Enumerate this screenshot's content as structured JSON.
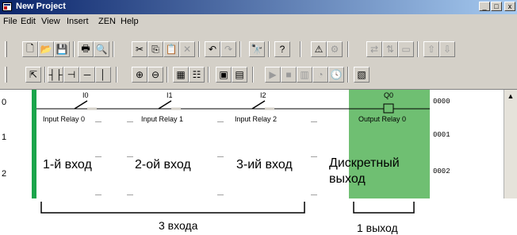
{
  "window": {
    "title": "New Project",
    "controls": [
      "_",
      "□",
      "x"
    ]
  },
  "menu": [
    "File",
    "Edit",
    "View",
    "Insert",
    "ZEN",
    "Help"
  ],
  "toolbar1": [
    {
      "icon": "new-file-icon",
      "glyph": "🗋"
    },
    {
      "icon": "open-folder-icon",
      "glyph": "📂"
    },
    {
      "icon": "save-icon",
      "glyph": "💾"
    },
    {
      "icon": "print-icon",
      "glyph": "🖶"
    },
    {
      "icon": "print-preview-icon",
      "glyph": "🔍"
    },
    {
      "icon": "cut-icon",
      "glyph": "✂"
    },
    {
      "icon": "copy-icon",
      "glyph": "⎘"
    },
    {
      "icon": "paste-icon",
      "glyph": "📋"
    },
    {
      "icon": "delete-icon",
      "glyph": "✕"
    },
    {
      "icon": "undo-icon",
      "glyph": "↶"
    },
    {
      "icon": "redo-icon",
      "glyph": "↷"
    },
    {
      "icon": "find-icon",
      "glyph": "🔭"
    },
    {
      "icon": "help-icon",
      "glyph": "?"
    },
    {
      "icon": "warning-check-icon",
      "glyph": "⚠"
    },
    {
      "icon": "compile-icon",
      "glyph": "⚙"
    },
    {
      "icon": "transfer-icon",
      "glyph": "⇄"
    },
    {
      "icon": "compare-icon",
      "glyph": "⇅"
    },
    {
      "icon": "monitor-icon",
      "glyph": "▭"
    },
    {
      "icon": "upload-icon",
      "glyph": "⇧"
    },
    {
      "icon": "download-icon",
      "glyph": "⇩"
    }
  ],
  "toolbar2": [
    {
      "icon": "pointer-icon",
      "glyph": "⇱"
    },
    {
      "icon": "contact-no-icon",
      "glyph": "┤├"
    },
    {
      "icon": "contact-nc-icon",
      "glyph": "⊣"
    },
    {
      "icon": "horizontal-line-icon",
      "glyph": "─"
    },
    {
      "icon": "vertical-line-icon",
      "glyph": "│"
    },
    {
      "icon": "zoom-in-icon",
      "glyph": "⊕"
    },
    {
      "icon": "zoom-out-icon",
      "glyph": "⊖"
    },
    {
      "icon": "grid-icon",
      "glyph": "▦"
    },
    {
      "icon": "settings-icon",
      "glyph": "☷"
    },
    {
      "icon": "monitor-mode-icon",
      "glyph": "▣"
    },
    {
      "icon": "program-mode-icon",
      "glyph": "▤"
    },
    {
      "icon": "run-icon",
      "glyph": "▶"
    },
    {
      "icon": "stop-icon",
      "glyph": "■"
    },
    {
      "icon": "io-table-icon",
      "glyph": "▥"
    },
    {
      "icon": "timer-icon",
      "glyph": "◔"
    },
    {
      "icon": "clock-icon",
      "glyph": "🕓"
    },
    {
      "icon": "display-icon",
      "glyph": "▧"
    }
  ],
  "ladder": {
    "rows": [
      "0",
      "1",
      "2"
    ],
    "rule_numbers": [
      "0000",
      "0001",
      "0002"
    ],
    "contacts": [
      {
        "address": "I0",
        "label": "Input Relay 0"
      },
      {
        "address": "I1",
        "label": "Input Relay 1"
      },
      {
        "address": "I2",
        "label": "Input Relay 2"
      }
    ],
    "output": {
      "address": "Q0",
      "label": "Output Relay 0"
    }
  },
  "overlay": {
    "input_labels": [
      "1-й вход",
      "2-ой вход",
      "3-ий вход"
    ],
    "output_label_line1": "Дискретный",
    "output_label_line2": "выход",
    "inputs_caption": "3 входа",
    "output_caption": "1 выход"
  },
  "colors": {
    "output_block": "#6fbf72",
    "power_rail": "#1aa54b",
    "titlebar": "#0a246a"
  }
}
